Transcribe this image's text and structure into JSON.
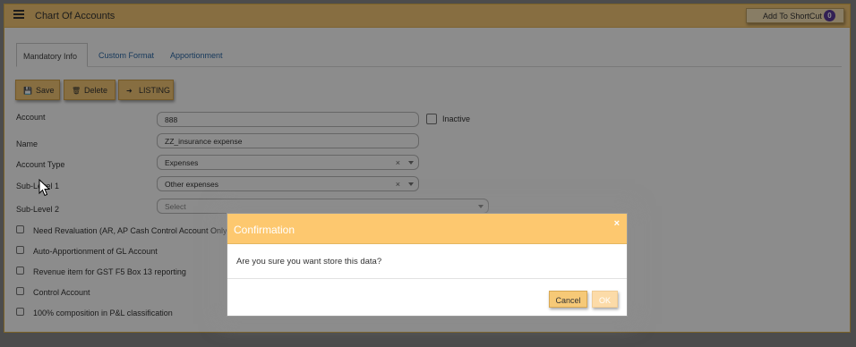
{
  "header": {
    "title": "Chart Of Accounts",
    "shortcut_label": "Add To ShortCut",
    "shortcut_count": "0"
  },
  "tabs": [
    {
      "label": "Mandatory Info",
      "active": true
    },
    {
      "label": "Custom Format",
      "active": false
    },
    {
      "label": "Apportionment",
      "active": false
    }
  ],
  "toolbar": {
    "save_label": "Save",
    "delete_label": "Delete",
    "listing_label": "LISTING"
  },
  "form": {
    "account_label": "Account",
    "account_value": "888",
    "inactive_label": "Inactive",
    "name_label": "Name",
    "name_value": "ZZ_insurance expense",
    "account_type_label": "Account Type",
    "account_type_value": "Expenses",
    "sublevel1_label": "Sub-Level 1",
    "sublevel1_value": "Other expenses",
    "sublevel2_label": "Sub-Level 2",
    "sublevel2_placeholder": "Select",
    "clear_glyph": "×"
  },
  "checkboxes": [
    {
      "label": "Need Revaluation (AR, AP Cash Control Account Only)"
    },
    {
      "label": "Auto-Apportionment of GL Account"
    },
    {
      "label": "Revenue item for GST F5 Box 13 reporting"
    },
    {
      "label": "Control Account"
    },
    {
      "label": "100% composition in P&L classification"
    }
  ],
  "dialog": {
    "title": "Confirmation",
    "close_glyph": "×",
    "message": "Are you sure you want store this data?",
    "cancel_label": "Cancel",
    "ok_label": "OK"
  },
  "colors": {
    "accent": "#f6c977",
    "dialog_header": "#fdc86f",
    "link": "#2c6aa8",
    "badge": "#5c3b99"
  }
}
